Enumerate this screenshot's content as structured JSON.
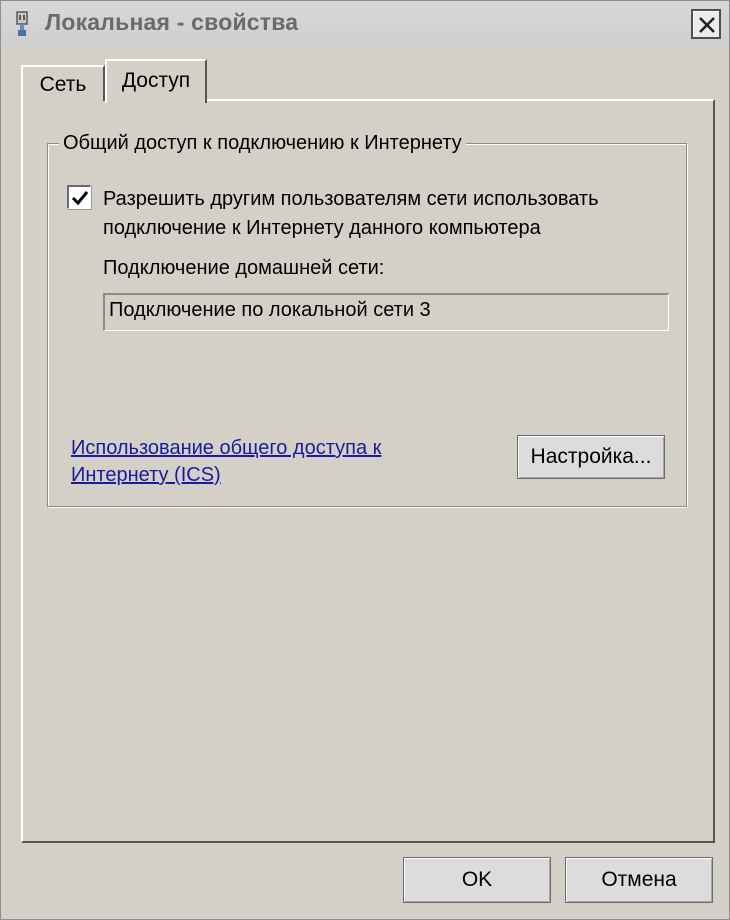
{
  "window": {
    "title": "Локальная - свойства",
    "icon": "network-adapter-icon",
    "close_icon": "close-icon"
  },
  "tabs": [
    {
      "label": "Сеть",
      "active": false
    },
    {
      "label": "Доступ",
      "active": true
    }
  ],
  "sharing_group": {
    "legend": "Общий доступ к подключению к Интернету",
    "allow_checkbox": {
      "checked": true,
      "label": "Разрешить другим пользователям сети использовать подключение к Интернету данного компьютера"
    },
    "home_network_label": "Подключение домашней сети:",
    "home_network_value": "Подключение по локальной сети 3",
    "ics_link": "Использование общего доступа к Интернету (ICS)",
    "settings_button": "Настройка..."
  },
  "footer": {
    "ok_label": "OK",
    "cancel_label": "Отмена"
  },
  "colors": {
    "background": "#d4d0c8",
    "link": "#1a1aa0",
    "title_text": "#6a6a6a"
  }
}
